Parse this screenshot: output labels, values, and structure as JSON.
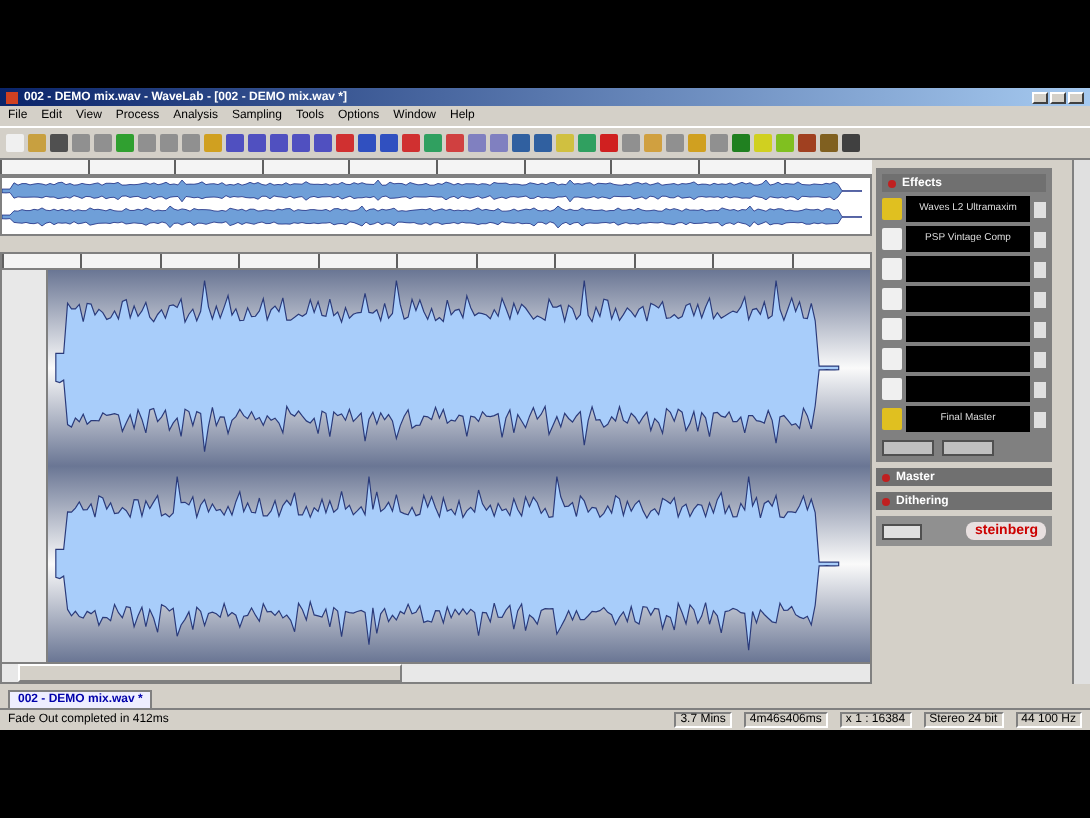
{
  "window": {
    "title": "002 - DEMO mix.wav - WaveLab - [002 - DEMO mix.wav *]"
  },
  "menu": [
    "File",
    "Edit",
    "View",
    "Process",
    "Analysis",
    "Sampling",
    "Tools",
    "Options",
    "Window",
    "Help"
  ],
  "effects": {
    "title": "Effects",
    "slots": [
      {
        "name": "Waves L2 Ultramaxim",
        "active": true
      },
      {
        "name": "PSP Vintage Comp",
        "active": false
      },
      {
        "active": false
      },
      {
        "active": false
      },
      {
        "active": false
      },
      {
        "active": false
      },
      {
        "active": false
      },
      {
        "name": "Final Master",
        "active": true
      }
    ]
  },
  "sections": [
    {
      "title": "Master"
    },
    {
      "title": "Dithering"
    }
  ],
  "logo": "steinberg",
  "document_tab": {
    "label": "002 - DEMO mix.wav *",
    "selected": true
  },
  "status_bar": {
    "message": "Fade Out completed in 412ms",
    "fields": [
      "3.7 Mins",
      "4m46s406ms",
      "x 1 : 16384",
      "Stereo 24 bit",
      "44 100 Hz"
    ]
  }
}
